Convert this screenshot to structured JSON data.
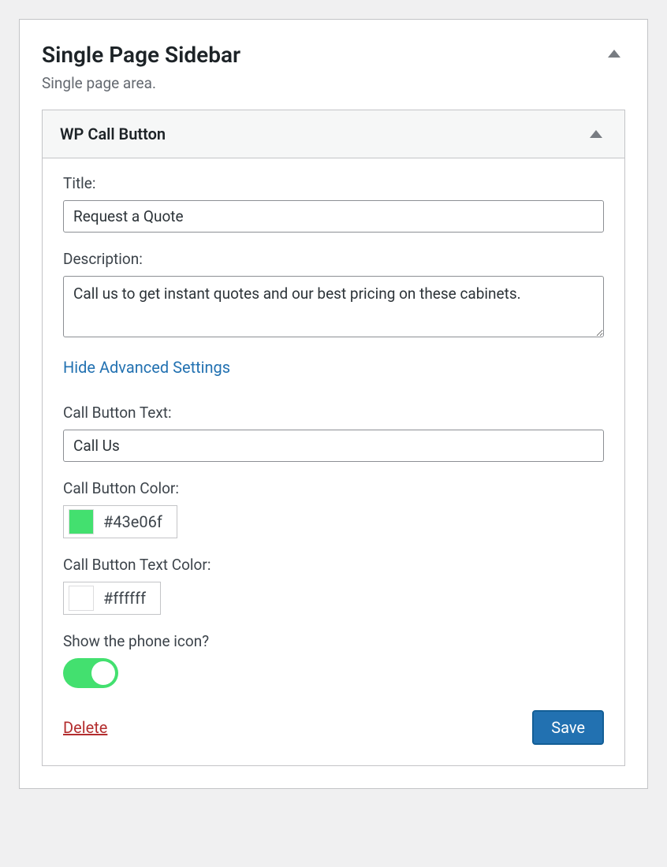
{
  "sidebar": {
    "title": "Single Page Sidebar",
    "description": "Single page area."
  },
  "widget": {
    "title": "WP Call Button"
  },
  "fields": {
    "title_label": "Title:",
    "title_value": "Request a Quote",
    "description_label": "Description:",
    "description_value": "Call us to get instant quotes and our best pricing on these cabinets.",
    "advanced_toggle": "Hide Advanced Settings",
    "button_text_label": "Call Button Text:",
    "button_text_value": "Call Us",
    "button_color_label": "Call Button Color:",
    "button_color_value": "#43e06f",
    "button_text_color_label": "Call Button Text Color:",
    "button_text_color_value": "#ffffff",
    "phone_icon_label": "Show the phone icon?",
    "phone_icon_on": true
  },
  "actions": {
    "delete": "Delete",
    "save": "Save"
  }
}
